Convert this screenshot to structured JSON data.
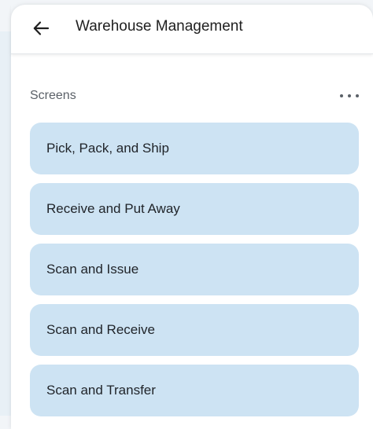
{
  "header": {
    "back_icon": "arrow-left-icon",
    "title": "Warehouse Management"
  },
  "section": {
    "label": "Screens",
    "more_icon": "more-horizontal-icon"
  },
  "screens": [
    {
      "label": "Pick, Pack, and Ship"
    },
    {
      "label": "Receive and Put Away"
    },
    {
      "label": "Scan and Issue"
    },
    {
      "label": "Scan and Receive"
    },
    {
      "label": "Scan and Transfer"
    }
  ],
  "colors": {
    "item_background": "#cde3f3",
    "panel_background": "#e8f0f6",
    "text_primary": "#1f1f1f",
    "text_secondary": "#5b6168"
  }
}
